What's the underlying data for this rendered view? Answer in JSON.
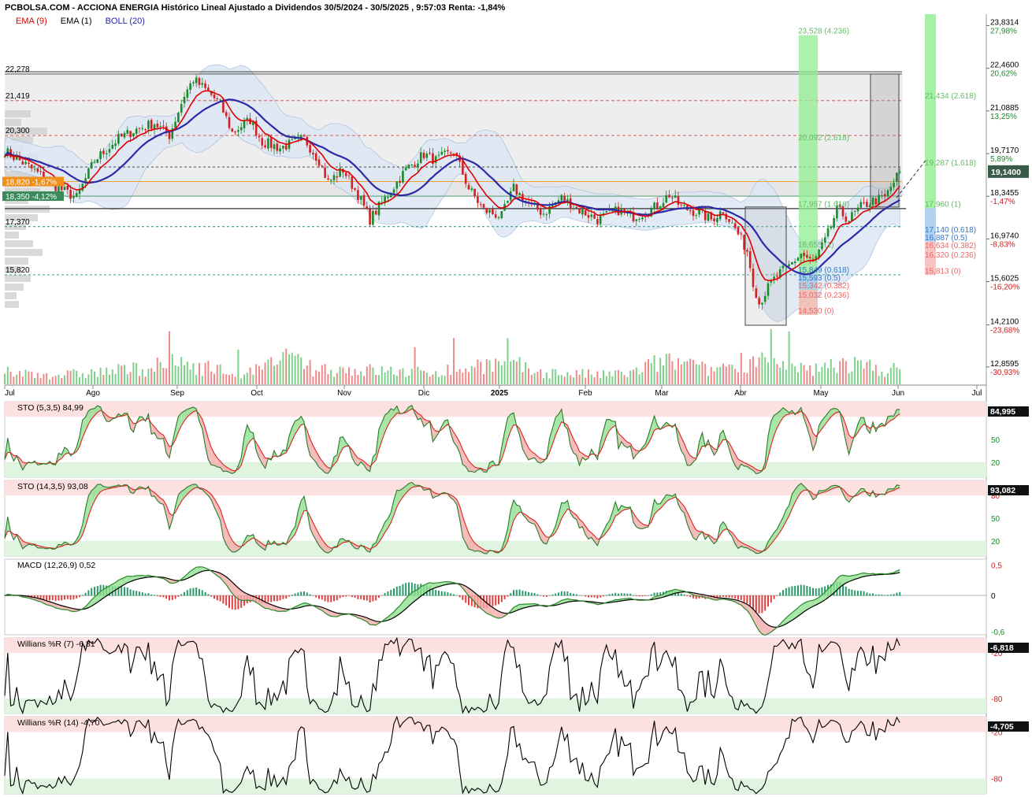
{
  "header": {
    "title": "PCBOLSA.COM - ACCIONA ENERGIA Histórico Lineal Ajustado a Dividendos 30/5/2024 - 30/5/2025 , 9:57:03 Renta: -1,84%"
  },
  "legend": [
    {
      "label": "EMA (9)",
      "color": "#e00000"
    },
    {
      "label": "EMA (1)",
      "color": "#000000"
    },
    {
      "label": "BOLL (20)",
      "color": "#2222aa"
    }
  ],
  "colors": {
    "ema9": "#e00000",
    "boll": "#2a2aa8",
    "band": "#dde7f5",
    "up": "#1a8a2a",
    "down": "#d02020",
    "fib_green": "#66bb66",
    "fib_blue": "#3377cc",
    "fib_red": "#ee6666",
    "osc_top": "#fde0e0",
    "osc_bot": "#dff5df"
  },
  "chart_data": [
    {
      "type": "line",
      "panel": "price",
      "ylim": [
        12.3,
        24.2
      ],
      "x_months": [
        "Jul",
        "Ago",
        "Sep",
        "Oct",
        "Nov",
        "Dic",
        "2025",
        "Feb",
        "Mar",
        "Abr",
        "May",
        "Jun",
        "Jul"
      ],
      "right_axis": [
        {
          "value": 23.8314,
          "label": "23,8314",
          "pct": "27,98%"
        },
        {
          "value": 22.46,
          "label": "22,4600",
          "pct": "20,62%"
        },
        {
          "value": 21.0885,
          "label": "21,0885",
          "pct": "13,25%"
        },
        {
          "value": 19.717,
          "label": "19,7170",
          "pct": "5,89%"
        },
        {
          "value": 18.3455,
          "label": "18,3455",
          "pct": "-1,47%"
        },
        {
          "value": 16.974,
          "label": "16,9740",
          "pct": "-8,83%"
        },
        {
          "value": 15.6025,
          "label": "15,6025",
          "pct": "-16,20%"
        },
        {
          "value": 14.21,
          "label": "14,2100",
          "pct": "-23,68%"
        },
        {
          "value": 12.8595,
          "label": "12,8595",
          "pct": "-30,93%"
        }
      ],
      "last_price": {
        "value": 19.14,
        "label": "19,1400"
      },
      "left_levels": [
        {
          "value": 22.278,
          "label": "22,278"
        },
        {
          "value": 21.419,
          "label": "21,419"
        },
        {
          "value": 20.3,
          "label": "20,300"
        },
        {
          "value": 17.37,
          "label": "17,370"
        },
        {
          "value": 15.82,
          "label": "15,820"
        }
      ],
      "tags": [
        {
          "value": 18.82,
          "label": "18,820 -1,67%",
          "color": "#f0901a"
        },
        {
          "value": 18.35,
          "label": "18,350 -4,12%",
          "color": "#3a8a5a"
        }
      ],
      "fib_labels": [
        {
          "value": 23.528,
          "label": "23,528 (4.236)",
          "color": "#66bb66",
          "group": "a"
        },
        {
          "value": 20.092,
          "label": "20,092 (2.618)",
          "color": "#66bb66",
          "group": "a"
        },
        {
          "value": 17.957,
          "label": "17,957 (1.618)",
          "color": "#66bb66",
          "group": "a"
        },
        {
          "value": 16.655,
          "label": "16,655 (1)",
          "color": "#66bb66",
          "group": "a"
        },
        {
          "value": 15.849,
          "label": "15,849 (0.618)",
          "color": "#3377cc",
          "group": "a"
        },
        {
          "value": 15.593,
          "label": "15,593 (0.5)",
          "color": "#3377cc",
          "group": "a"
        },
        {
          "value": 15.342,
          "label": "15,342 (0.382)",
          "color": "#ee6666",
          "group": "a"
        },
        {
          "value": 15.032,
          "label": "15,032 (0.236)",
          "color": "#ee6666",
          "group": "a"
        },
        {
          "value": 14.53,
          "label": "14,530 (0)",
          "color": "#ee6666",
          "group": "a"
        },
        {
          "value": 21.434,
          "label": "21,434 (2.618)",
          "color": "#66bb66",
          "group": "b"
        },
        {
          "value": 19.287,
          "label": "19,287 (1.618)",
          "color": "#66bb66",
          "group": "b"
        },
        {
          "value": 17.96,
          "label": "17,960 (1)",
          "color": "#66bb66",
          "group": "b"
        },
        {
          "value": 17.14,
          "label": "17,140 (0.618)",
          "color": "#3377cc",
          "group": "b"
        },
        {
          "value": 16.887,
          "label": "16,887 (0.5)",
          "color": "#3377cc",
          "group": "b"
        },
        {
          "value": 16.634,
          "label": "16,634 (0.382)",
          "color": "#ee6666",
          "group": "b"
        },
        {
          "value": 16.32,
          "label": "16,320 (0.236)",
          "color": "#ee6666",
          "group": "b"
        },
        {
          "value": 15.813,
          "label": "15,813 (0)",
          "color": "#ee6666",
          "group": "b"
        }
      ],
      "price_anchors": [
        [
          0,
          19.8
        ],
        [
          8,
          19.3
        ],
        [
          18,
          18.6
        ],
        [
          24,
          18.3
        ],
        [
          30,
          19.5
        ],
        [
          38,
          20.2
        ],
        [
          44,
          20.5
        ],
        [
          50,
          20.7
        ],
        [
          55,
          20.3
        ],
        [
          60,
          21.6
        ],
        [
          63,
          22.1
        ],
        [
          68,
          21.7
        ],
        [
          72,
          21.3
        ],
        [
          76,
          20.4
        ],
        [
          82,
          20.8
        ],
        [
          86,
          20.1
        ],
        [
          92,
          19.9
        ],
        [
          100,
          20.2
        ],
        [
          105,
          19.5
        ],
        [
          108,
          18.8
        ],
        [
          113,
          19.2
        ],
        [
          118,
          18.4
        ],
        [
          122,
          17.6
        ],
        [
          128,
          18.4
        ],
        [
          134,
          19.2
        ],
        [
          140,
          19.7
        ],
        [
          144,
          19.5
        ],
        [
          150,
          19.8
        ],
        [
          155,
          18.6
        ],
        [
          160,
          17.9
        ],
        [
          166,
          17.7
        ],
        [
          170,
          18.6
        ],
        [
          175,
          18.1
        ],
        [
          180,
          17.8
        ],
        [
          186,
          18.3
        ],
        [
          192,
          17.9
        ],
        [
          198,
          17.6
        ],
        [
          205,
          17.9
        ],
        [
          210,
          17.7
        ],
        [
          216,
          17.9
        ],
        [
          222,
          18.4
        ],
        [
          226,
          18.0
        ],
        [
          232,
          17.8
        ],
        [
          236,
          17.6
        ],
        [
          240,
          17.9
        ],
        [
          244,
          17.3
        ],
        [
          248,
          16.6
        ],
        [
          250,
          15.6
        ],
        [
          252,
          14.9
        ],
        [
          255,
          15.4
        ],
        [
          258,
          15.8
        ],
        [
          262,
          16.1
        ],
        [
          266,
          16.5
        ],
        [
          270,
          16.2
        ],
        [
          274,
          16.9
        ],
        [
          278,
          17.9
        ],
        [
          282,
          17.6
        ],
        [
          286,
          18.0
        ],
        [
          290,
          18.2
        ],
        [
          294,
          18.3
        ],
        [
          297,
          18.8
        ],
        [
          299,
          19.14
        ]
      ],
      "volume_anchors": [
        [
          0,
          0.25
        ],
        [
          20,
          0.2
        ],
        [
          40,
          0.3
        ],
        [
          60,
          0.45
        ],
        [
          80,
          0.2
        ],
        [
          95,
          0.55
        ],
        [
          100,
          0.35
        ],
        [
          120,
          0.3
        ],
        [
          140,
          0.25
        ],
        [
          155,
          0.35
        ],
        [
          160,
          0.45
        ],
        [
          180,
          0.25
        ],
        [
          200,
          0.2
        ],
        [
          210,
          0.25
        ],
        [
          220,
          0.5
        ],
        [
          235,
          0.3
        ],
        [
          250,
          0.55
        ],
        [
          260,
          0.35
        ],
        [
          270,
          0.3
        ],
        [
          280,
          0.45
        ],
        [
          290,
          0.35
        ],
        [
          299,
          0.3
        ]
      ]
    },
    {
      "type": "line",
      "panel": "sto1",
      "title": "STO (5,3,5)",
      "last": "84,99",
      "tag": "84,995",
      "ylim": [
        0,
        100
      ],
      "zones": [
        20,
        80
      ],
      "ticks": [
        "50",
        "20"
      ]
    },
    {
      "type": "line",
      "panel": "sto2",
      "title": "STO (14,3,5)",
      "last": "93,08",
      "tag": "93,082",
      "ylim": [
        0,
        100
      ],
      "zones": [
        20,
        80
      ],
      "ticks": [
        "80",
        "50",
        "20"
      ]
    },
    {
      "type": "line",
      "panel": "macd",
      "title": "MACD (12,26,9)",
      "last": "0,52",
      "ylim": [
        -0.65,
        0.6
      ],
      "ticks": [
        {
          "v": 0.5,
          "label": "0,5"
        },
        {
          "v": 0,
          "label": "0"
        },
        {
          "v": -0.6,
          "label": "-0,6"
        }
      ]
    },
    {
      "type": "line",
      "panel": "wr7",
      "title": "Willians %R (7)",
      "last": "-6,81",
      "tag": "-6,818",
      "ylim": [
        -100,
        0
      ],
      "zones": [
        -80,
        -20
      ],
      "ticks": [
        "-20",
        "-80"
      ]
    },
    {
      "type": "line",
      "panel": "wr14",
      "title": "Willians %R (14)",
      "last": "-4,70",
      "tag": "-4,705",
      "ylim": [
        -100,
        0
      ],
      "zones": [
        -80,
        -20
      ],
      "ticks": [
        "-20",
        "-80"
      ]
    }
  ]
}
